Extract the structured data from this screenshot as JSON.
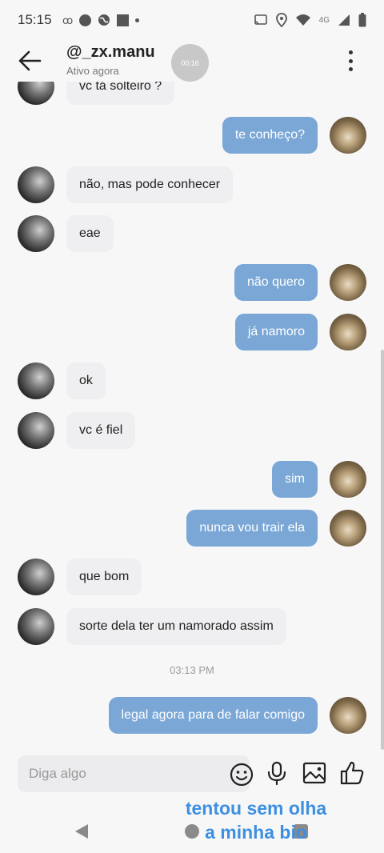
{
  "status_bar": {
    "time": "15:15",
    "network": "4G",
    "icons": [
      "sync-icon",
      "circle-icon",
      "globe-icon",
      "square-icon",
      "dot-icon",
      "cast-icon",
      "location-icon",
      "wifi-icon",
      "signal-icon",
      "battery-icon"
    ]
  },
  "header": {
    "username": "@_zx.manu",
    "presence": "Ativo agora",
    "timer": "00:16",
    "back_icon": "arrow-left-icon",
    "more_icon": "more-vertical-icon"
  },
  "messages": [
    {
      "dir": "in",
      "text": "vc tá solteiro ?"
    },
    {
      "dir": "out",
      "text": "te conheço?"
    },
    {
      "dir": "in",
      "text": "não, mas pode conhecer"
    },
    {
      "dir": "in",
      "text": "eae"
    },
    {
      "dir": "out",
      "text": "não quero"
    },
    {
      "dir": "out",
      "text": "já namoro"
    },
    {
      "dir": "in",
      "text": "ok"
    },
    {
      "dir": "in",
      "text": "vc é fiel"
    },
    {
      "dir": "out",
      "text": "sim"
    },
    {
      "dir": "out",
      "text": "nunca vou trair ela"
    },
    {
      "dir": "in",
      "text": "que bom"
    },
    {
      "dir": "in",
      "text": "sorte dela ter um namorado assim"
    },
    {
      "dir": "out",
      "text": "legal agora para de falar comigo"
    }
  ],
  "timestamp": "03:13 PM",
  "input": {
    "placeholder": "Diga algo",
    "icons": [
      "emoji-icon",
      "microphone-icon",
      "image-icon",
      "thumbs-up-icon"
    ]
  },
  "overlay": {
    "line1": "tentou sem olha",
    "line2": "a minha bio"
  },
  "colors": {
    "outgoing_bubble": "#7aa7d6",
    "incoming_bubble": "#efeff1",
    "overlay_text": "#3d8fe0"
  }
}
